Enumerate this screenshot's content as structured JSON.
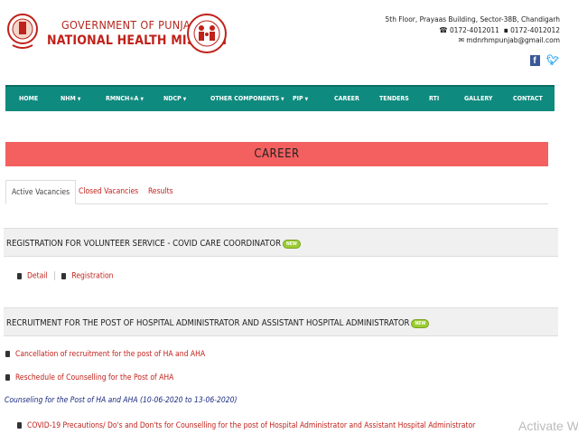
{
  "header": {
    "gov_title": "GOVERNMENT OF PUNJAB",
    "nhm_title": "NATIONAL HEALTH MISSION",
    "address_line": "5th Floor, Prayaas Building, Sector-38B, Chandigarh",
    "phone1": "0172-4012011",
    "phone2": "0172-4012012",
    "email": "mdnrhmpunjab@gmail.com"
  },
  "nav": {
    "items": [
      {
        "label": "HOME",
        "dropdown": false
      },
      {
        "label": "NHM",
        "dropdown": true
      },
      {
        "label": "RMNCH+A",
        "dropdown": true
      },
      {
        "label": "NDCP",
        "dropdown": true
      },
      {
        "label": "OTHER COMPONENTS",
        "dropdown": true
      },
      {
        "label": "PIP",
        "dropdown": true
      },
      {
        "label": "CAREER",
        "dropdown": false
      },
      {
        "label": "TENDERS",
        "dropdown": false
      },
      {
        "label": "RTI",
        "dropdown": false
      },
      {
        "label": "GALLERY",
        "dropdown": false
      },
      {
        "label": "CONTACT",
        "dropdown": false
      }
    ]
  },
  "banner": {
    "title": "CAREER"
  },
  "tabs": [
    {
      "label": "Active Vacancies",
      "active": true
    },
    {
      "label": "Closed Vacancies",
      "active": false
    },
    {
      "label": "Results",
      "active": false
    }
  ],
  "sections": [
    {
      "title": "REGISTRATION FOR VOLUNTEER SERVICE - COVID CARE COORDINATOR",
      "badge": "NEW",
      "links": [
        {
          "label": "Detail"
        },
        {
          "label": "Registration"
        }
      ]
    },
    {
      "title": "RECRUITMENT FOR THE POST OF HOSPITAL ADMINISTRATOR AND ASSISTANT HOSPITAL ADMINISTRATOR",
      "badge": "NEW",
      "links": [
        {
          "label": "Cancellation of recruitment for the post of HA and AHA"
        },
        {
          "label": "Reschedule of Counselling for the Post of AHA"
        }
      ],
      "subheading": "Counseling for the Post of HA and AHA (10-06-2020 to 13-06-2020)",
      "sub_links": [
        {
          "label": "COVID-19 Precautions/ Do's and Don'ts for Counselling for the post of Hospital Administrator and Assistant Hospital Administrator"
        }
      ]
    }
  ],
  "watermark": "Activate Wi"
}
